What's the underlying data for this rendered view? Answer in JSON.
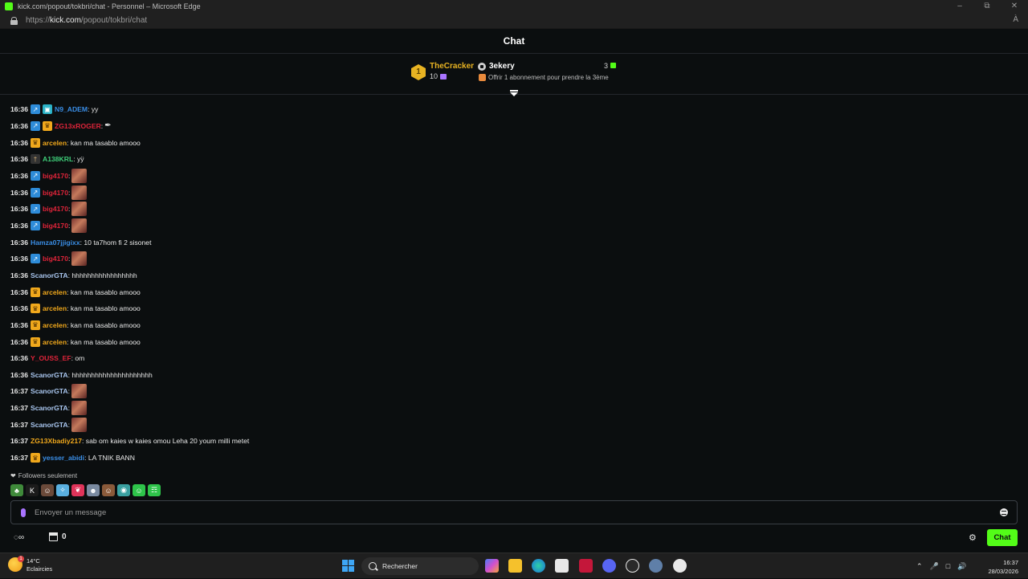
{
  "browser": {
    "window_title": "kick.com/popout/tokbri/chat - Personnel – Microsoft Edge",
    "url_prefix": "https://",
    "url_domain": "kick.com",
    "url_path": "/popout/tokbri/chat",
    "read_aloud": "À"
  },
  "chat": {
    "title": "Chat"
  },
  "leaderboard": {
    "rank": "1",
    "top_user": "TheCracker",
    "top_count": "10",
    "target_user": "3ekery",
    "target_count": "3",
    "offer_text": "Offrir 1 abonnement pour prendre la 3ème"
  },
  "messages": [
    {
      "time": "16:36",
      "badges": [
        "bot",
        "sub"
      ],
      "user": "N9_ADEM",
      "color": "#3a8ee6",
      "text": ": yy"
    },
    {
      "time": "16:36",
      "badges": [
        "bot",
        "crown"
      ],
      "user": "ZG13xROGER",
      "color": "#e0243a",
      "text": ":",
      "emote": "feather"
    },
    {
      "time": "16:36",
      "badges": [
        "crown"
      ],
      "user": "arcelen",
      "color": "#f0a81c",
      "text": ": kan ma tasablo amooo"
    },
    {
      "time": "16:36",
      "badges": [
        "other"
      ],
      "user": "A138KRL",
      "color": "#3fd07a",
      "text": ": yÿ"
    },
    {
      "time": "16:36",
      "badges": [
        "bot"
      ],
      "user": "big4170",
      "color": "#e0243a",
      "text": ":",
      "emote": "img"
    },
    {
      "time": "16:36",
      "badges": [
        "bot"
      ],
      "user": "big4170",
      "color": "#e0243a",
      "text": ":",
      "emote": "img"
    },
    {
      "time": "16:36",
      "badges": [
        "bot"
      ],
      "user": "big4170",
      "color": "#e0243a",
      "text": ":",
      "emote": "img"
    },
    {
      "time": "16:36",
      "badges": [
        "bot"
      ],
      "user": "big4170",
      "color": "#e0243a",
      "text": ":",
      "emote": "img"
    },
    {
      "time": "16:36",
      "badges": [],
      "user": "Hamza07jjigixx",
      "color": "#3a8ee6",
      "text": ": 10 ta7hom fi 2 sisonet"
    },
    {
      "time": "16:36",
      "badges": [
        "bot"
      ],
      "user": "big4170",
      "color": "#e0243a",
      "text": ":",
      "emote": "img"
    },
    {
      "time": "16:36",
      "badges": [],
      "user": "ScanorGTA",
      "color": "#a9c6ef",
      "text": ": hhhhhhhhhhhhhhhhh"
    },
    {
      "time": "16:36",
      "badges": [
        "crown"
      ],
      "user": "arcelen",
      "color": "#f0a81c",
      "text": ": kan ma tasablo amooo"
    },
    {
      "time": "16:36",
      "badges": [
        "crown"
      ],
      "user": "arcelen",
      "color": "#f0a81c",
      "text": ": kan ma tasablo amooo"
    },
    {
      "time": "16:36",
      "badges": [
        "crown"
      ],
      "user": "arcelen",
      "color": "#f0a81c",
      "text": ": kan ma tasablo amooo"
    },
    {
      "time": "16:36",
      "badges": [
        "crown"
      ],
      "user": "arcelen",
      "color": "#f0a81c",
      "text": ": kan ma tasablo amooo"
    },
    {
      "time": "16:36",
      "badges": [],
      "user": "Y_OUSS_EF",
      "color": "#e0243a",
      "text": ": om"
    },
    {
      "time": "16:36",
      "badges": [],
      "user": "ScanorGTA",
      "color": "#a9c6ef",
      "text": ": hhhhhhhhhhhhhhhhhhhhh"
    },
    {
      "time": "16:37",
      "badges": [],
      "user": "ScanorGTA",
      "color": "#a9c6ef",
      "text": ":",
      "emote": "img"
    },
    {
      "time": "16:37",
      "badges": [],
      "user": "ScanorGTA",
      "color": "#a9c6ef",
      "text": ":",
      "emote": "img"
    },
    {
      "time": "16:37",
      "badges": [],
      "user": "ScanorGTA",
      "color": "#a9c6ef",
      "text": ":",
      "emote": "img"
    },
    {
      "time": "16:37",
      "badges": [],
      "user": "ZG13Xbadiy217",
      "color": "#f0a81c",
      "text": ": sab om kaies w kaies omou Leha 20 youm milli metet"
    },
    {
      "time": "16:37",
      "badges": [
        "crown"
      ],
      "user": "yesser_abidi",
      "color": "#3a8ee6",
      "text": ": LA TNIK BANN"
    }
  ],
  "footer": {
    "followers_only": "Followers seulement",
    "input_placeholder": "Envoyer un message",
    "points": "0",
    "send_label": "Chat"
  },
  "emote_bar": [
    "frog-emote",
    "kick-emote",
    "face-emote",
    "bird-emote",
    "ribbon-emote",
    "person-emote",
    "cat-emote",
    "globe-emote",
    "green-face-emote",
    "slime-emote"
  ],
  "taskbar": {
    "temperature": "14°C",
    "weather": "Eclaircies",
    "weather_alert": "1",
    "search_label": "Rechercher",
    "time": "16:37",
    "date": "28/03/2026"
  }
}
